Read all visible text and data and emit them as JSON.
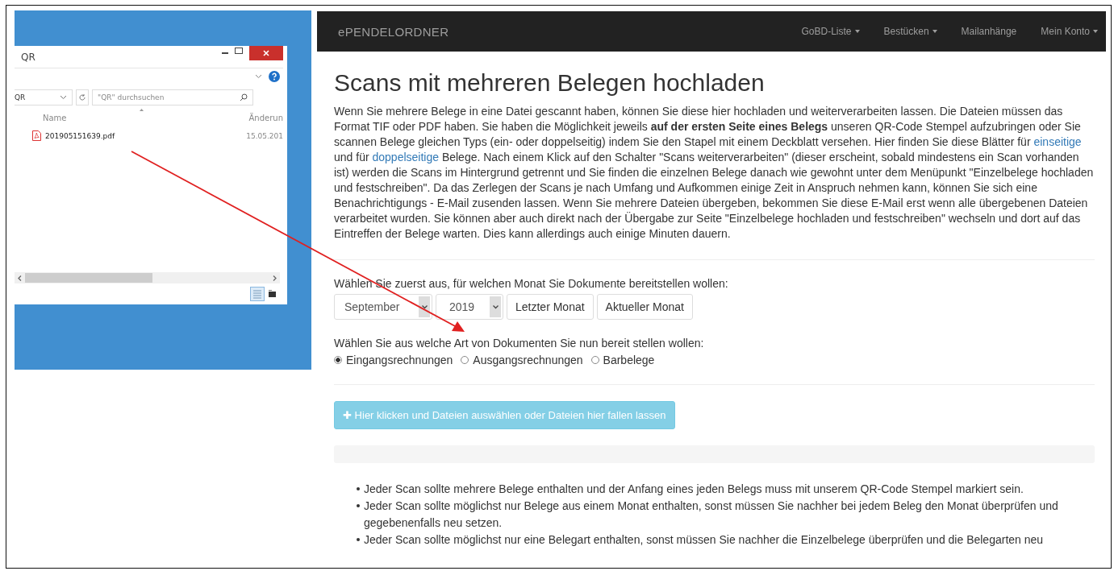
{
  "explorer": {
    "title": "QR",
    "address": "QR",
    "search": {
      "placeholder": "\"QR\" durchsuchen"
    },
    "columns": [
      "Name",
      "Änderun"
    ],
    "files": [
      {
        "name": "201905151639.pdf",
        "modified": "15.05.201"
      }
    ]
  },
  "navbar": {
    "brand": "ePENDELORDNER",
    "items": [
      {
        "label": "GoBD-Liste",
        "dropdown": true
      },
      {
        "label": "Bestücken",
        "dropdown": true
      },
      {
        "label": "Mailanhänge",
        "dropdown": false
      },
      {
        "label": "Mein Konto",
        "dropdown": true
      }
    ]
  },
  "heading": "Scans mit mehreren Belegen hochladen",
  "intro": [
    {
      "kind": "text",
      "text": "Wenn Sie mehrere Belege in eine Datei gescannt haben, können Sie diese hier hochladen und weiterverarbeiten lassen. Die Dateien müssen das Format TIF oder PDF haben. Sie haben die Möglichkeit jeweils **auf der ersten Seite eines Belegs** unseren QR-Code Stempel aufzubringen oder Sie scannen Belege gleichen Typs (ein- oder doppelseitig) indem Sie den Stapel mit einem Deckblatt versehen. Hier finden Sie diese Blätter für "
    },
    {
      "kind": "link",
      "text": "einseitige"
    },
    {
      "kind": "text",
      "text": " und für "
    },
    {
      "kind": "link",
      "text": "doppelseitige"
    },
    {
      "kind": "text",
      "text": " Belege. Nach einem Klick auf den Schalter \"Scans weiterverarbeiten\" (dieser erscheint, sobald mindestens ein Scan vorhanden ist) werden die Scans im Hintergrund getrennt und Sie finden die einzelnen Belege danach wie gewohnt unter dem Menüpunkt \"Einzelbelege hochladen und festschreiben\". Da das Zerlegen der Scans je nach Umfang und Aufkommen einige Zeit in Anspruch nehmen kann, können Sie sich eine Benachrichtigungs - E-Mail zusenden lassen. Wenn Sie mehrere Dateien übergeben, bekommen Sie diese E-Mail erst wenn alle übergebenen Dateien verarbeitet wurden. Sie können aber auch direkt nach der Übergabe zur Seite \"Einzelbelege hochladen und festschreiben\" wechseln und dort auf das Eintreffen der Belege warten. Dies kann allerdings auch einige Minuten dauern."
    }
  ],
  "month_prompt": "Wählen Sie zuerst aus, für welchen Monat Sie Dokumente bereitstellen wollen:",
  "month": "September",
  "year": "2019",
  "month_buttons": [
    "Letzter Monat",
    "Aktueller Monat"
  ],
  "type_prompt": "Wählen Sie aus welche Art von Dokumenten Sie nun bereit stellen wollen:",
  "types": [
    {
      "label": "Eingangsrechnungen",
      "selected": true
    },
    {
      "label": "Ausgangsrechnungen",
      "selected": false
    },
    {
      "label": "Barbelege",
      "selected": false
    }
  ],
  "upload_button": {
    "icon": "✚",
    "label": "Hier klicken und Dateien auswählen oder Dateien hier fallen lassen"
  },
  "hints": [
    "Jeder Scan sollte mehrere Belege enthalten und der Anfang eines jeden Belegs muss mit unserem QR-Code Stempel markiert sein.",
    "Jeder Scan sollte möglichst nur Belege aus einem Monat enthalten, sonst müssen Sie nachher bei jedem Beleg den Monat überprüfen und gegebenenfalls neu setzen.",
    "Jeder Scan sollte möglichst nur eine Belegart enthalten, sonst müssen Sie nachher die Einzelbelege überprüfen und die Belegarten neu"
  ]
}
